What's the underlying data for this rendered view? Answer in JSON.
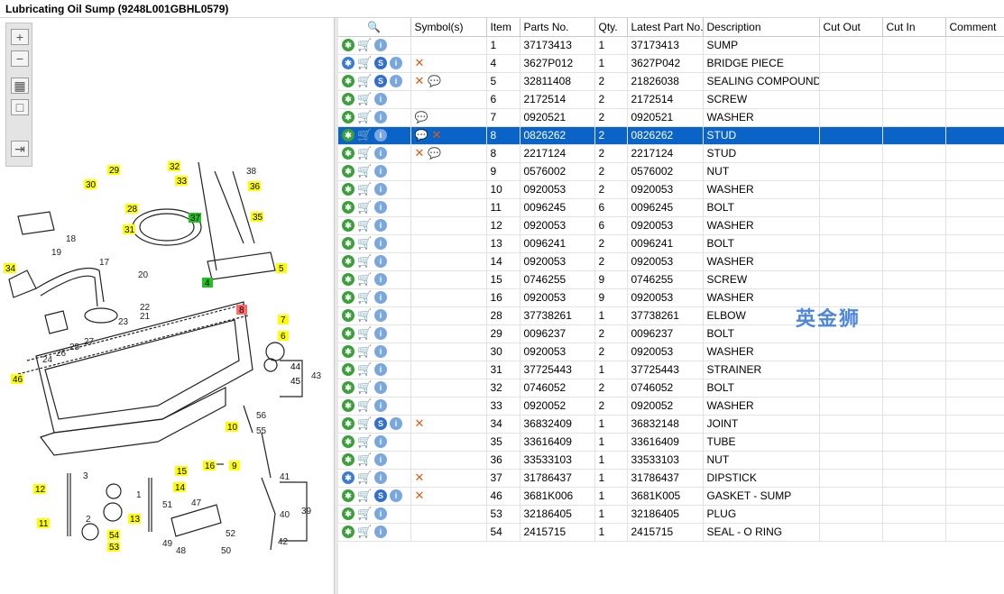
{
  "window": {
    "title": "Lubricating Oil Sump (9248L001GBHL0579)"
  },
  "toolbar": {
    "zoom_in_icon": "zoom-in-icon",
    "zoom_out_icon": "zoom-out-icon",
    "fit_icon": "fit-all-icon",
    "actual_icon": "actual-size-icon",
    "export_icon": "export-icon"
  },
  "grid": {
    "columns": [
      "",
      "Symbol(s)",
      "Item",
      "Parts No.",
      "Qty.",
      "Latest Part No.",
      "Description",
      "Cut Out",
      "Cut In",
      "Comment"
    ],
    "rows": [
      {
        "icons": [
          "gear",
          "cart",
          "info"
        ],
        "symbols": [],
        "item": "1",
        "part": "37173413",
        "qty": "1",
        "latest": "37173413",
        "desc": "SUMP"
      },
      {
        "icons": [
          "gear-multi",
          "cart",
          "s",
          "info"
        ],
        "symbols": [
          "x"
        ],
        "item": "4",
        "part": "3627P012",
        "qty": "1",
        "latest": "3627P042",
        "desc": "BRIDGE PIECE"
      },
      {
        "icons": [
          "gear",
          "cart",
          "s",
          "info"
        ],
        "symbols": [
          "x",
          "bubble"
        ],
        "item": "5",
        "part": "32811408",
        "qty": "2",
        "latest": "21826038",
        "desc": "SEALING COMPOUND"
      },
      {
        "icons": [
          "gear",
          "cart",
          "info"
        ],
        "symbols": [],
        "item": "6",
        "part": "2172514",
        "qty": "2",
        "latest": "2172514",
        "desc": "SCREW"
      },
      {
        "icons": [
          "gear",
          "cart",
          "info"
        ],
        "symbols": [
          "bubble"
        ],
        "item": "7",
        "part": "0920521",
        "qty": "2",
        "latest": "0920521",
        "desc": "WASHER"
      },
      {
        "icons": [
          "gear",
          "cart",
          "info"
        ],
        "symbols": [
          "bubble",
          "x"
        ],
        "item": "8",
        "part": "0826262",
        "qty": "2",
        "latest": "0826262",
        "desc": "STUD",
        "selected": true
      },
      {
        "icons": [
          "gear",
          "cart",
          "info"
        ],
        "symbols": [
          "x",
          "bubble"
        ],
        "item": "8",
        "part": "2217124",
        "qty": "2",
        "latest": "2217124",
        "desc": "STUD"
      },
      {
        "icons": [
          "gear",
          "cart",
          "info"
        ],
        "symbols": [],
        "item": "9",
        "part": "0576002",
        "qty": "2",
        "latest": "0576002",
        "desc": "NUT"
      },
      {
        "icons": [
          "gear",
          "cart",
          "info"
        ],
        "symbols": [],
        "item": "10",
        "part": "0920053",
        "qty": "2",
        "latest": "0920053",
        "desc": "WASHER"
      },
      {
        "icons": [
          "gear",
          "cart",
          "info"
        ],
        "symbols": [],
        "item": "11",
        "part": "0096245",
        "qty": "6",
        "latest": "0096245",
        "desc": "BOLT"
      },
      {
        "icons": [
          "gear",
          "cart",
          "info"
        ],
        "symbols": [],
        "item": "12",
        "part": "0920053",
        "qty": "6",
        "latest": "0920053",
        "desc": "WASHER"
      },
      {
        "icons": [
          "gear",
          "cart",
          "info"
        ],
        "symbols": [],
        "item": "13",
        "part": "0096241",
        "qty": "2",
        "latest": "0096241",
        "desc": "BOLT"
      },
      {
        "icons": [
          "gear",
          "cart",
          "info"
        ],
        "symbols": [],
        "item": "14",
        "part": "0920053",
        "qty": "2",
        "latest": "0920053",
        "desc": "WASHER"
      },
      {
        "icons": [
          "gear",
          "cart",
          "info"
        ],
        "symbols": [],
        "item": "15",
        "part": "0746255",
        "qty": "9",
        "latest": "0746255",
        "desc": "SCREW"
      },
      {
        "icons": [
          "gear",
          "cart",
          "info"
        ],
        "symbols": [],
        "item": "16",
        "part": "0920053",
        "qty": "9",
        "latest": "0920053",
        "desc": "WASHER"
      },
      {
        "icons": [
          "gear",
          "cart",
          "info"
        ],
        "symbols": [],
        "item": "28",
        "part": "37738261",
        "qty": "1",
        "latest": "37738261",
        "desc": "ELBOW"
      },
      {
        "icons": [
          "gear",
          "cart",
          "info"
        ],
        "symbols": [],
        "item": "29",
        "part": "0096237",
        "qty": "2",
        "latest": "0096237",
        "desc": "BOLT"
      },
      {
        "icons": [
          "gear",
          "cart",
          "info"
        ],
        "symbols": [],
        "item": "30",
        "part": "0920053",
        "qty": "2",
        "latest": "0920053",
        "desc": "WASHER"
      },
      {
        "icons": [
          "gear",
          "cart",
          "info"
        ],
        "symbols": [],
        "item": "31",
        "part": "37725443",
        "qty": "1",
        "latest": "37725443",
        "desc": "STRAINER"
      },
      {
        "icons": [
          "gear",
          "cart",
          "info"
        ],
        "symbols": [],
        "item": "32",
        "part": "0746052",
        "qty": "2",
        "latest": "0746052",
        "desc": "BOLT"
      },
      {
        "icons": [
          "gear",
          "cart",
          "info"
        ],
        "symbols": [],
        "item": "33",
        "part": "0920052",
        "qty": "2",
        "latest": "0920052",
        "desc": "WASHER"
      },
      {
        "icons": [
          "gear",
          "cart",
          "s",
          "info"
        ],
        "symbols": [
          "x"
        ],
        "item": "34",
        "part": "36832409",
        "qty": "1",
        "latest": "36832148",
        "desc": "JOINT"
      },
      {
        "icons": [
          "gear",
          "cart",
          "info"
        ],
        "symbols": [],
        "item": "35",
        "part": "33616409",
        "qty": "1",
        "latest": "33616409",
        "desc": "TUBE"
      },
      {
        "icons": [
          "gear",
          "cart",
          "info"
        ],
        "symbols": [],
        "item": "36",
        "part": "33533103",
        "qty": "1",
        "latest": "33533103",
        "desc": "NUT"
      },
      {
        "icons": [
          "gear-multi",
          "cart",
          "info"
        ],
        "symbols": [
          "x"
        ],
        "item": "37",
        "part": "31786437",
        "qty": "1",
        "latest": "31786437",
        "desc": "DIPSTICK"
      },
      {
        "icons": [
          "gear",
          "cart",
          "s",
          "info"
        ],
        "symbols": [
          "x"
        ],
        "item": "46",
        "part": "3681K006",
        "qty": "1",
        "latest": "3681K005",
        "desc": "GASKET - SUMP"
      },
      {
        "icons": [
          "gear",
          "cart",
          "info"
        ],
        "symbols": [],
        "item": "53",
        "part": "32186405",
        "qty": "1",
        "latest": "32186405",
        "desc": "PLUG"
      },
      {
        "icons": [
          "gear",
          "cart",
          "info"
        ],
        "symbols": [],
        "item": "54",
        "part": "2415715",
        "qty": "1",
        "latest": "2415715",
        "desc": "SEAL - O RING"
      }
    ]
  },
  "watermark": "英金狮",
  "diagram": {
    "callouts": [
      "29",
      "32",
      "30",
      "33",
      "36",
      "28",
      "37",
      "35",
      "31",
      "34",
      "5",
      "4",
      "8",
      "7",
      "6",
      "46",
      "44",
      "45",
      "10",
      "16",
      "9",
      "15",
      "14",
      "12",
      "13",
      "11",
      "54",
      "53"
    ],
    "plain_labels": [
      "38",
      "18",
      "19",
      "17",
      "20",
      "22",
      "21",
      "23",
      "27",
      "25",
      "26",
      "24",
      "43",
      "56",
      "55",
      "3",
      "2",
      "1",
      "51",
      "47",
      "49",
      "48",
      "50",
      "52",
      "41",
      "40",
      "39",
      "42"
    ]
  },
  "colors": {
    "selection": "#0a64c8",
    "callout": "#ffff00",
    "highlight_green": "#22c022",
    "highlight_red": "#ff6b6b"
  }
}
